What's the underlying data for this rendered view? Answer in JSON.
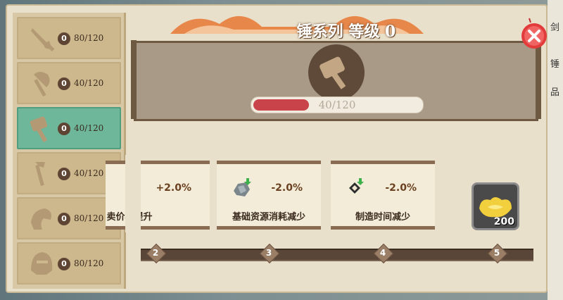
{
  "title": "锤系列 等级 0",
  "sidebar": {
    "items": [
      {
        "icon": "sword-icon",
        "level": "0",
        "count": "80/120",
        "selected": false
      },
      {
        "icon": "axe-icon",
        "level": "0",
        "count": "40/120",
        "selected": false
      },
      {
        "icon": "hammer-icon",
        "level": "0",
        "count": "40/120",
        "selected": true
      },
      {
        "icon": "pickaxe-icon",
        "level": "0",
        "count": "40/120",
        "selected": false
      },
      {
        "icon": "gauntlet-icon",
        "level": "0",
        "count": "80/120",
        "selected": false
      },
      {
        "icon": "helmet-icon",
        "level": "0",
        "count": "80/120",
        "selected": false
      }
    ]
  },
  "progress": {
    "text": "40/120",
    "value": 40,
    "max": 120
  },
  "cards": [
    {
      "bonus": "+2.0%",
      "label": "卖价格提升"
    },
    {
      "bonus": "-2.0%",
      "label": "基础资源消耗减少"
    },
    {
      "bonus": "-2.0%",
      "label": "制造时间减少"
    }
  ],
  "track": {
    "nodes": [
      "2",
      "3",
      "4",
      "5"
    ]
  },
  "reward": {
    "icon": "gold-ingot-icon",
    "count": "200"
  },
  "right_edge": [
    "剑",
    "锤",
    "品"
  ],
  "colors": {
    "selected": "#6fb79a",
    "progress_fill": "#c8434a",
    "panel": "#a89a86"
  }
}
